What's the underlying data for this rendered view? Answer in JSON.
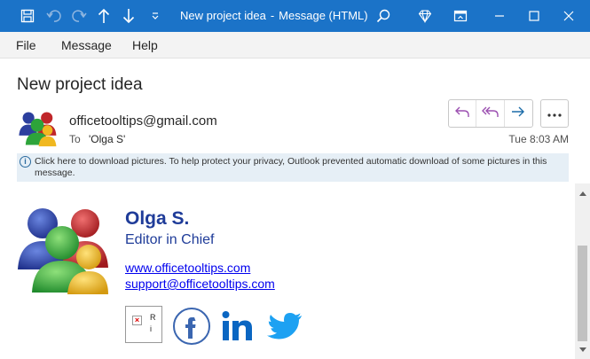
{
  "window": {
    "title": "New project idea",
    "separator": "-",
    "app_name": "Message (HTML)"
  },
  "menu": {
    "items": [
      "File",
      "Message",
      "Help"
    ]
  },
  "message": {
    "subject": "New project idea",
    "from": "officetooltips@gmail.com",
    "to_label": "To",
    "to_value": "'Olga S'",
    "date": "Tue 8:03 AM"
  },
  "infobar": {
    "text": "Click here to download pictures. To help protect your privacy, Outlook prevented automatic download of some pictures in this message."
  },
  "signature": {
    "name": "Olga S.",
    "title": "Editor in Chief",
    "website": "www.officetooltips.com",
    "email": "support@officetooltips.com",
    "broken_image_text": "R\ni"
  },
  "colors": {
    "titlebar": "#1b73c8",
    "signature_blue": "#1f3c99",
    "link": "#0000ee",
    "facebook": "#3b66b0",
    "linkedin": "#0a66c2",
    "twitter": "#1da1f2"
  },
  "icons": [
    "save-icon",
    "undo-icon",
    "redo-icon",
    "arrow-up-icon",
    "arrow-down-icon",
    "customize-toolbar-icon",
    "search-icon",
    "premium-icon",
    "restore-ribbon-icon",
    "minimize-icon",
    "maximize-icon",
    "close-icon",
    "reply-icon",
    "reply-all-icon",
    "forward-icon",
    "more-icon",
    "info-icon",
    "facebook-icon",
    "linkedin-icon",
    "twitter-icon"
  ]
}
